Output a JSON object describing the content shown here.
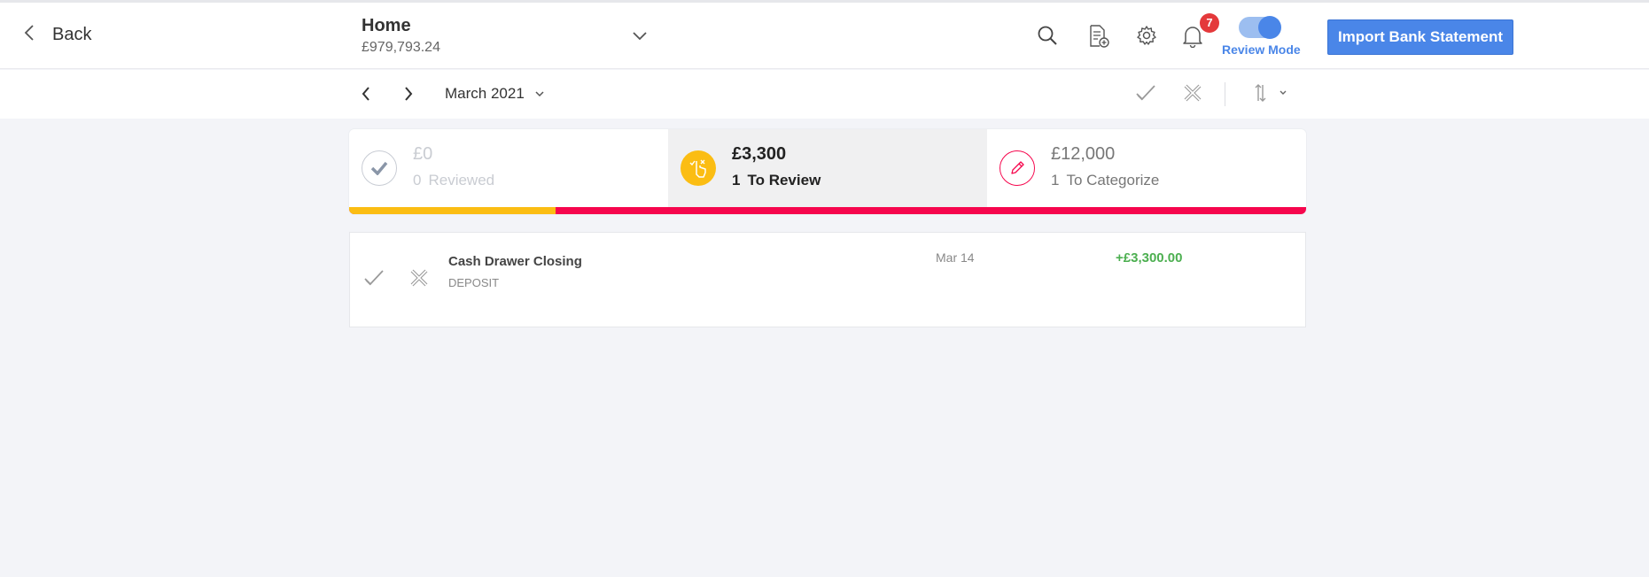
{
  "header": {
    "back_label": "Back",
    "account_name": "Home",
    "account_balance": "£979,793.24",
    "notification_count": "7",
    "review_mode_label": "Review Mode",
    "review_mode_on": true,
    "import_button_label": "Import Bank Statement",
    "icons": [
      "chevron-left-icon",
      "chevron-down-icon",
      "search-icon",
      "document-add-icon",
      "gear-icon",
      "bell-icon"
    ]
  },
  "period_bar": {
    "period_label": "March 2021",
    "icons": [
      "chevron-left-icon",
      "chevron-right-icon",
      "chevron-down-icon",
      "check-icon",
      "x-icon",
      "sort-icon"
    ]
  },
  "summary": {
    "reviewed": {
      "amount": "£0",
      "count": "0",
      "label": "Reviewed"
    },
    "to_review": {
      "amount": "£3,300",
      "count": "1",
      "label": "To Review"
    },
    "to_categorize": {
      "amount": "£12,000",
      "count": "1",
      "label": "To Categorize"
    },
    "progress_share_to_review": 0.2157
  },
  "transactions": [
    {
      "name": "Cash Drawer Closing",
      "type": "DEPOSIT",
      "date": "Mar 14",
      "amount": "+£3,300.00"
    }
  ],
  "colors": {
    "accent_blue": "#4a86e8",
    "review_yellow": "#fbbd13",
    "categorize_red": "#f6064d",
    "positive_green": "#4caf50",
    "badge_red": "#e4393b"
  }
}
